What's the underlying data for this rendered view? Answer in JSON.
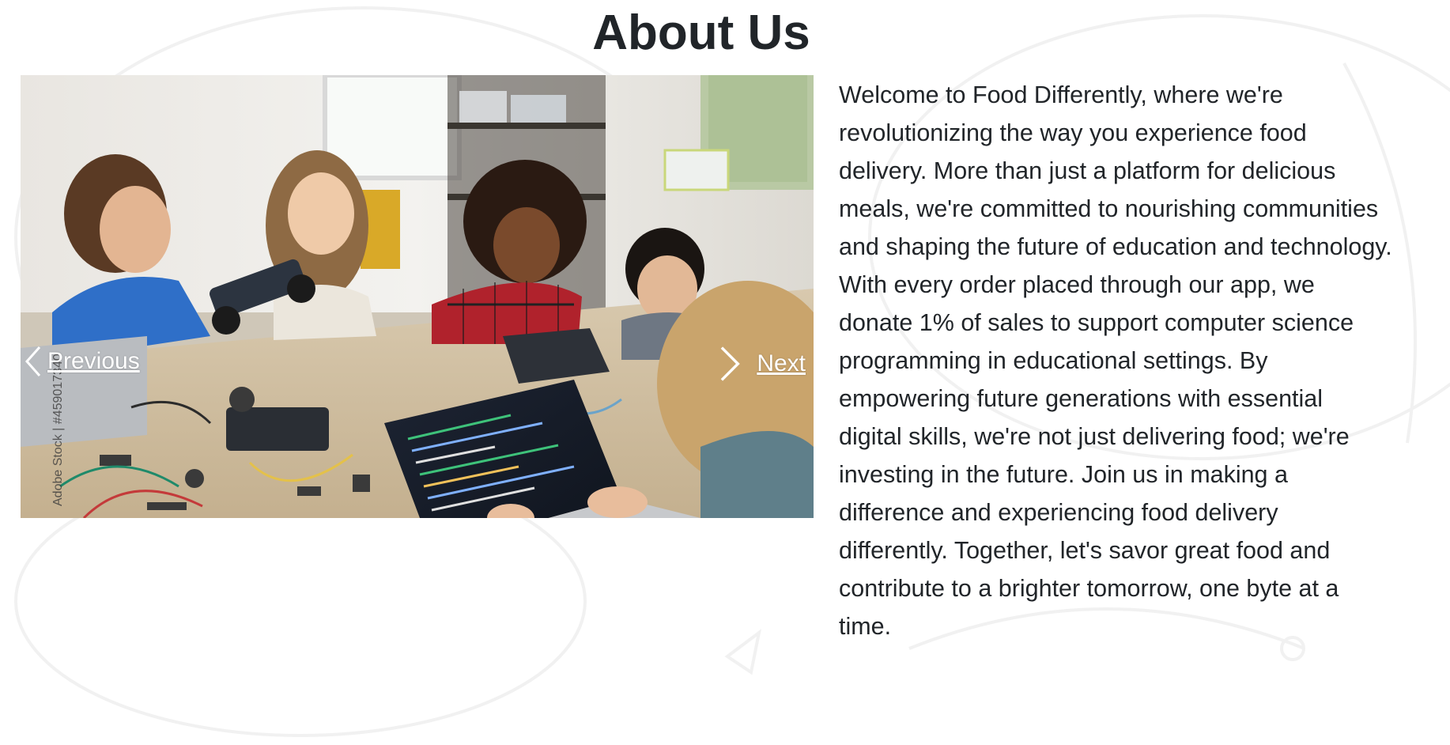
{
  "section": {
    "title": "About Us"
  },
  "carousel": {
    "prev_label": "Previous",
    "next_label": "Next",
    "image_alt": "Children working with laptops and robotics electronics at a table",
    "watermark": "Adobe Stock | #459017340"
  },
  "about": {
    "text": "Welcome to Food Differently, where we're revolutionizing the way you experience food delivery. More than just a platform for delicious meals, we're committed to nourishing communities and shaping the future of education and technology. With every order placed through our app, we donate 1% of sales to support computer science programming in educational settings. By empowering future generations with essential digital skills, we're not just delivering food; we're investing in the future. Join us in making a difference and experiencing food delivery differently. Together, let's savor great food and contribute to a brighter tomorrow, one byte at a time."
  },
  "icons": {
    "prev": "chevron-left-icon",
    "next": "chevron-right-icon"
  },
  "colors": {
    "text": "#212529",
    "background": "#ffffff",
    "control": "#ffffff"
  }
}
